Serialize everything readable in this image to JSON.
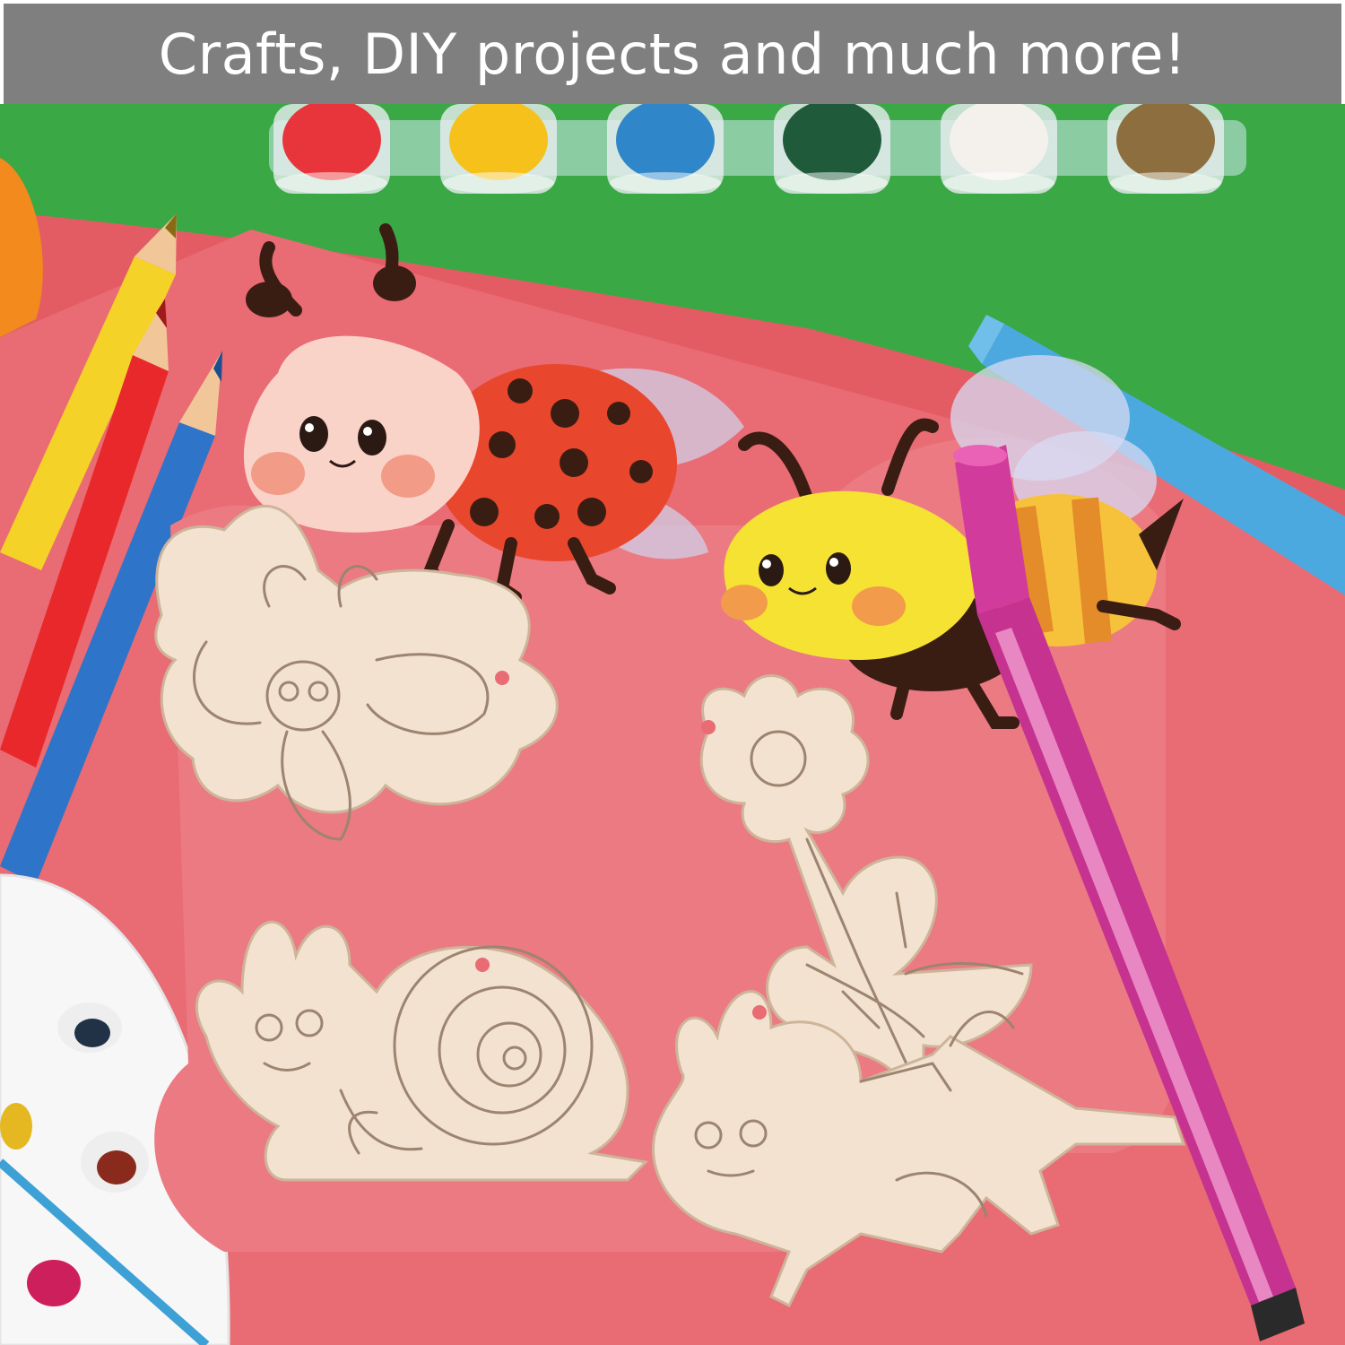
{
  "banner": {
    "text": "Crafts, DIY projects and much more!",
    "background": "#7f7f7f",
    "text_color": "#ffffff"
  },
  "scene": {
    "background_colors": {
      "red_paper": "#e45c63",
      "green_paper": "#3aa845",
      "pink_board": "#e96b74"
    },
    "paint_pots": [
      {
        "name": "red-paint-pot",
        "color": "#e8353b"
      },
      {
        "name": "yellow-paint-pot",
        "color": "#f5c11a"
      },
      {
        "name": "blue-paint-pot",
        "color": "#2f86c8"
      },
      {
        "name": "green-paint-pot",
        "color": "#1f5a3a"
      },
      {
        "name": "white-paint-pot",
        "color": "#f4f1ec"
      },
      {
        "name": "brown-paint-pot",
        "color": "#8c6e3f"
      }
    ],
    "pencils": [
      {
        "name": "yellow-pencil",
        "color": "#f4d228"
      },
      {
        "name": "red-pencil",
        "color": "#e8282b"
      },
      {
        "name": "blue-pencil",
        "color": "#2e74c9"
      }
    ],
    "markers": [
      {
        "name": "light-blue-marker",
        "color": "#4ba9e0"
      },
      {
        "name": "magenta-marker",
        "color": "#c6328f"
      }
    ],
    "painted_figures": [
      "ladybug",
      "bee"
    ],
    "wood_cutouts": [
      "butterfly",
      "flower",
      "snail",
      "ant"
    ]
  }
}
